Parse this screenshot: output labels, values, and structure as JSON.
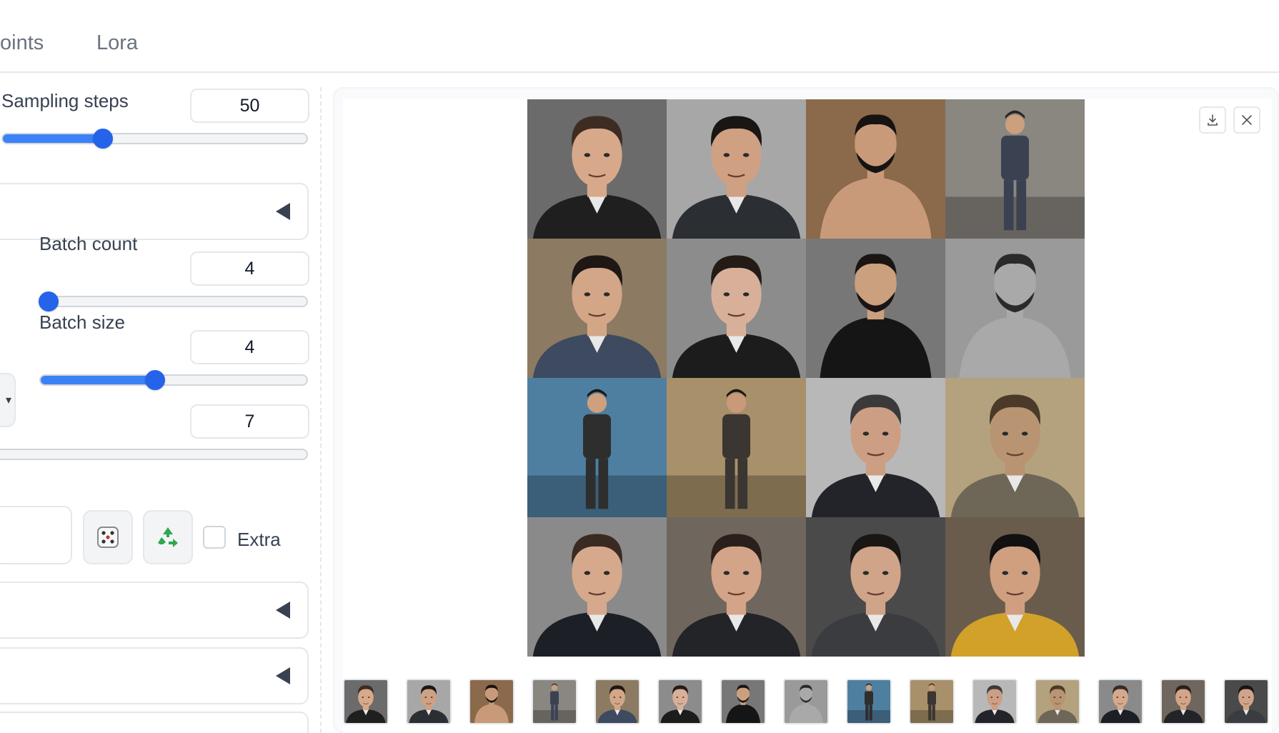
{
  "tabs": [
    {
      "label": "oints"
    },
    {
      "label": "Lora"
    }
  ],
  "sampling": {
    "label": "Sampling steps",
    "value": "50",
    "fraction": 0.33
  },
  "batch_count": {
    "label": "Batch count",
    "value": "4",
    "fraction": 0.03
  },
  "batch_size": {
    "label": "Batch size",
    "value": "4",
    "fraction": 0.43
  },
  "cfg": {
    "value": "7"
  },
  "extra": {
    "label": "Extra"
  },
  "icons": {
    "dice": "dice-icon",
    "recycle": "recycle-icon",
    "download": "download-icon",
    "close": "close-icon"
  },
  "gallery": {
    "images": [
      {
        "bg": "#6b6b6b",
        "skin": "#d7a98a",
        "hair": "#3e2c22",
        "cloth": "#1f1f1f",
        "pose": "portrait"
      },
      {
        "bg": "#a7a7a7",
        "skin": "#d0a083",
        "hair": "#1a1614",
        "cloth": "#2b2e33",
        "pose": "portrait"
      },
      {
        "bg": "#8a6a4a",
        "skin": "#c99a7a",
        "hair": "#161312",
        "cloth": "#c99a7a",
        "pose": "shirtless"
      },
      {
        "bg": "#8a8680",
        "skin": "#caa07e",
        "hair": "#2a2420",
        "cloth": "#3a4252",
        "pose": "standing"
      },
      {
        "bg": "#8c7a62",
        "skin": "#d2a687",
        "hair": "#1e1714",
        "cloth": "#3e4a5f",
        "pose": "portrait"
      },
      {
        "bg": "#8c8c8c",
        "skin": "#d8b09a",
        "hair": "#241b17",
        "cloth": "#1c1c1c",
        "pose": "portrait"
      },
      {
        "bg": "#777777",
        "skin": "#cba07f",
        "hair": "#1a1413",
        "cloth": "#151515",
        "pose": "shirtless"
      },
      {
        "bg": "#9a9a9a",
        "skin": "#a9a9a9",
        "hair": "#2a2a2a",
        "cloth": "#a9a9a9",
        "pose": "shirtless"
      },
      {
        "bg": "#4f7fa0",
        "skin": "#cfa07e",
        "hair": "#1a1614",
        "cloth": "#2e2e2e",
        "pose": "standing"
      },
      {
        "bg": "#a8906a",
        "skin": "#c99a7a",
        "hair": "#1a1614",
        "cloth": "#3b3632",
        "pose": "standing"
      },
      {
        "bg": "#b8b8b8",
        "skin": "#cc9e84",
        "hair": "#3a3a3a",
        "cloth": "#22242a",
        "pose": "portrait"
      },
      {
        "bg": "#b4a27e",
        "skin": "#b99472",
        "hair": "#4b3a29",
        "cloth": "#6e6656",
        "pose": "portrait"
      },
      {
        "bg": "#8a8a8a",
        "skin": "#d6a98c",
        "hair": "#3a2b22",
        "cloth": "#1c1f26",
        "pose": "portrait"
      },
      {
        "bg": "#6f665d",
        "skin": "#d3a487",
        "hair": "#2a1f1a",
        "cloth": "#222428",
        "pose": "portrait"
      },
      {
        "bg": "#4a4a4a",
        "skin": "#d0a488",
        "hair": "#1a1614",
        "cloth": "#3a3c40",
        "pose": "portrait"
      },
      {
        "bg": "#6a5c4c",
        "skin": "#cf9f80",
        "hair": "#111111",
        "cloth": "#d1a12a",
        "pose": "portrait"
      }
    ]
  }
}
